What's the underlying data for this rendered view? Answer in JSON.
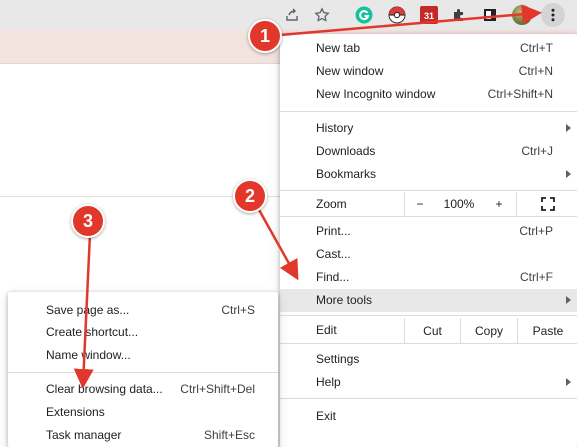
{
  "colors": {
    "annotation_red": "#e2372b",
    "toolbar_bg": "#e8e8e8",
    "strip_bg": "#f3e3df",
    "highlight": "#e8e8e8"
  },
  "toolbar": {
    "icons": [
      "share-icon",
      "bookmark-star-icon",
      "grammarly-extension-icon",
      "pokeball-extension-icon",
      "calendar-extension-icon",
      "extensions-puzzle-icon",
      "sidebar-icon",
      "profile-avatar",
      "chrome-menu-kebab-icon"
    ],
    "calendar_icon_text": "31"
  },
  "chrome_menu": {
    "new_tab": {
      "label": "New tab",
      "shortcut": "Ctrl+T"
    },
    "new_window": {
      "label": "New window",
      "shortcut": "Ctrl+N"
    },
    "new_incognito": {
      "label": "New Incognito window",
      "shortcut": "Ctrl+Shift+N"
    },
    "history": {
      "label": "History"
    },
    "downloads": {
      "label": "Downloads",
      "shortcut": "Ctrl+J"
    },
    "bookmarks": {
      "label": "Bookmarks"
    },
    "zoom": {
      "label": "Zoom",
      "minus": "−",
      "value": "100%",
      "plus": "+"
    },
    "print": {
      "label": "Print...",
      "shortcut": "Ctrl+P"
    },
    "cast": {
      "label": "Cast..."
    },
    "find": {
      "label": "Find...",
      "shortcut": "Ctrl+F"
    },
    "more_tools": {
      "label": "More tools"
    },
    "edit": {
      "label": "Edit",
      "cut": "Cut",
      "copy": "Copy",
      "paste": "Paste"
    },
    "settings": {
      "label": "Settings"
    },
    "help": {
      "label": "Help"
    },
    "exit": {
      "label": "Exit"
    }
  },
  "more_tools_menu": {
    "save_page": {
      "label": "Save page as...",
      "shortcut": "Ctrl+S"
    },
    "create_shortcut": {
      "label": "Create shortcut..."
    },
    "name_window": {
      "label": "Name window..."
    },
    "clear_browsing": {
      "label": "Clear browsing data...",
      "shortcut": "Ctrl+Shift+Del"
    },
    "extensions": {
      "label": "Extensions"
    },
    "task_manager": {
      "label": "Task manager",
      "shortcut": "Shift+Esc"
    }
  },
  "annotations": {
    "step1": "1",
    "step2": "2",
    "step3": "3"
  }
}
